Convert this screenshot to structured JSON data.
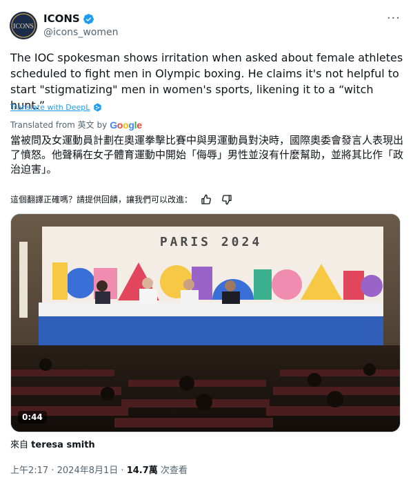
{
  "author": {
    "display_name": "ICONS",
    "handle": "@icons_women",
    "avatar_text": "ICONS"
  },
  "tweet": {
    "text": "The IOC spokesman shows irritation when asked about female athletes scheduled to fight men in Olympic boxing. He claims it's not helpful to start \"stigmatizing\" men in women's sports, likening it to a “witch hunt.”",
    "deepl_link": "Translate with DeepL"
  },
  "translation": {
    "translated_from": "Translated from 英文 by",
    "provider": "Google",
    "text": "當被問及女運動員計劃在奧運拳擊比賽中與男運動員對決時，國際奧委會發言人表現出了憤怒。他聲稱在女子體育運動中開始「侮辱」男性並沒有什麼幫助，並將其比作「政治迫害」。",
    "rate_prompt": "這個翻譯正確嗎？請提供回饋，讓我們可以改進："
  },
  "media": {
    "duration": "0:44",
    "banner_text": "PARIS 2024"
  },
  "source": {
    "prefix": "來自",
    "name": "teresa smith"
  },
  "meta": {
    "time": "上午2:17",
    "date": "2024年8月1日",
    "separator": "·",
    "views_count": "14.7萬",
    "views_label": "次查看"
  },
  "colors": {
    "accent": "#1d9bf0",
    "secondary_text": "#536471",
    "google_blue": "#4285f4",
    "google_red": "#ea4335",
    "google_yellow": "#fbbc05",
    "google_green": "#34a853"
  },
  "icons": [
    "verified-badge-icon",
    "more-options-icon",
    "deepl-icon",
    "thumbs-up-icon",
    "thumbs-down-icon"
  ]
}
